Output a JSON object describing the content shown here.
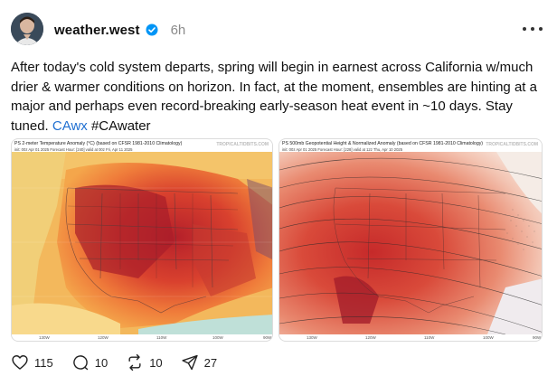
{
  "post": {
    "username": "weather.west",
    "timestamp": "6h",
    "text_main": "After today's cold system departs, spring will begin in earnest across California w/much drier & warmer conditions on horizon. In fact, at the moment, ensembles are hinting at a major and perhaps even record-breaking early-season heat event in ~10 days. Stay tuned. ",
    "tag1": "CAwx",
    "tag2": " #CAwater"
  },
  "images": {
    "left": {
      "title": "PS 2-meter Temperature Anomaly (°C) (based on CFSR 1981-2010 Climatology)",
      "subtitle": "init: 00z Apr 01 2025    Forecast Hour: [240]    valid at 00z Fri, Apr 11 2025",
      "credit": "TROPICALTIDBITS.COM",
      "axis": [
        "130W",
        "120W",
        "110W",
        "100W",
        "90W"
      ]
    },
    "right": {
      "title": "PS 500mb Geopotential Height & Normalized Anomaly (based on CFSR 1981-2010 Climatology)",
      "subtitle": "init: 00z Apr 01 2025    Forecast Hour: [228]    valid at 12z Thu, Apr 10 2025",
      "credit": "TROPICALTIDBITS.COM",
      "axis": [
        "130W",
        "120W",
        "110W",
        "100W",
        "90W"
      ]
    }
  },
  "actions": {
    "likes": "115",
    "comments": "10",
    "reposts": "10",
    "shares": "27"
  },
  "colors": {
    "link": "#1f6fd1",
    "verified": "#0095f6"
  }
}
